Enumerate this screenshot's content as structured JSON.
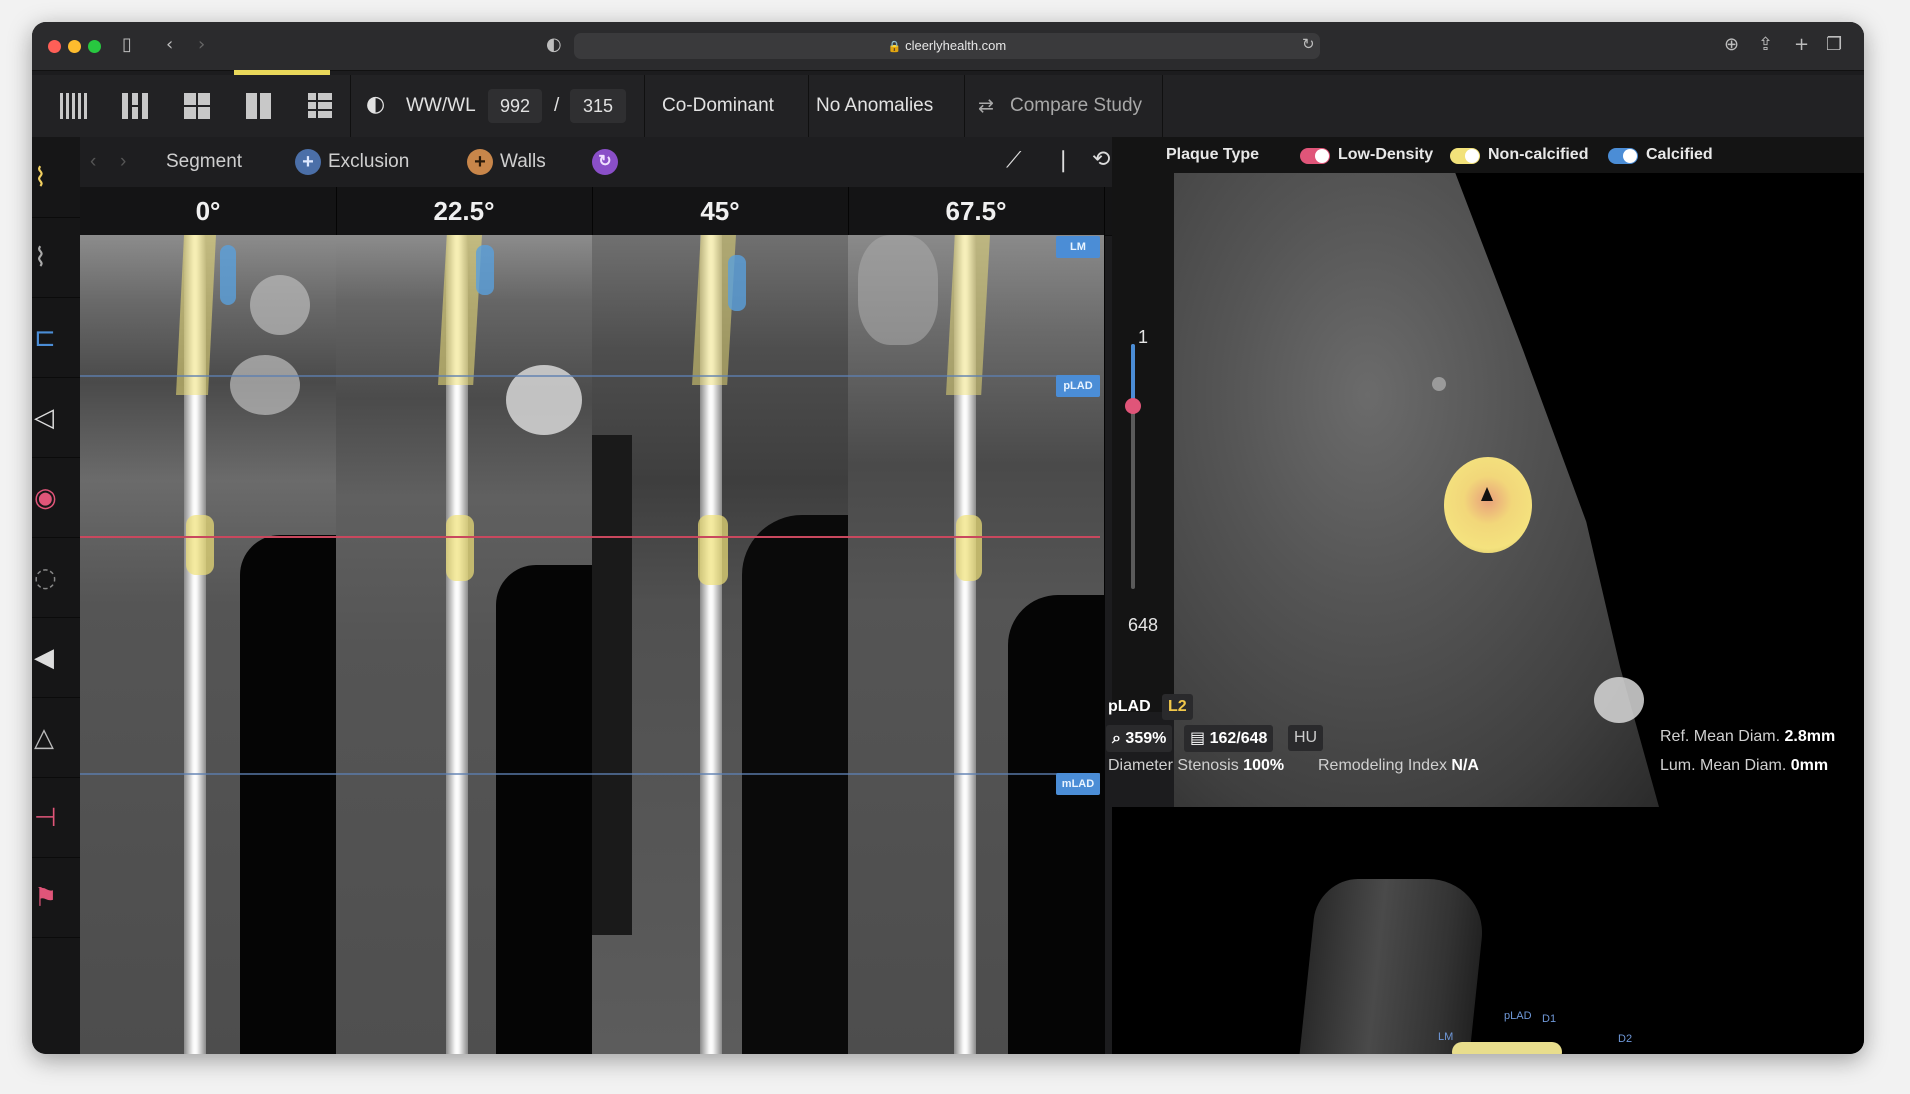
{
  "browser": {
    "url": "cleerlyhealth.com"
  },
  "toolbar": {
    "wwwl_label": "WW/WL",
    "ww_value": "992",
    "wl_separator": "/",
    "wl_value": "315",
    "dominance": "Co-Dominant",
    "anomalies": "No Anomalies",
    "compare": "Compare Study"
  },
  "subbar": {
    "segment": "Segment",
    "exclusion": "Exclusion",
    "walls": "Walls"
  },
  "angles": [
    "0°",
    "22.5°",
    "45°",
    "67.5°"
  ],
  "segment_tags": {
    "lm": "LM",
    "plad": "pLAD",
    "mlad": "mLAD"
  },
  "slider": {
    "min": "1",
    "max": "648",
    "position_fraction": 0.21
  },
  "legend": {
    "title": "Plaque Type",
    "items": [
      {
        "label": "Low-Density",
        "color": "#e05579"
      },
      {
        "label": "Non-calcified",
        "color": "#f2e27a"
      },
      {
        "label": "Calcified",
        "color": "#4b8dd6"
      }
    ]
  },
  "xsec": {
    "segment": "pLAD",
    "level": "L2",
    "zoom": "359%",
    "slice": "162/648",
    "unit": "HU",
    "stenosis_label": "Diameter Stenosis",
    "stenosis_value": "100%",
    "remodeling_label": "Remodeling Index",
    "remodeling_value": "N/A",
    "ref_label": "Ref. Mean Diam.",
    "ref_value": "2.8mm",
    "lum_label": "Lum. Mean Diam.",
    "lum_value": "0mm"
  },
  "vr_labels": {
    "lm": "LM",
    "plad": "pLAD",
    "d1": "D1",
    "d2": "D2"
  },
  "colors": {
    "accent": "#e9d85a",
    "seg_tag": "#4b8dd6",
    "blue_line": "#5c7fb0",
    "red_line": "#c9485e"
  }
}
